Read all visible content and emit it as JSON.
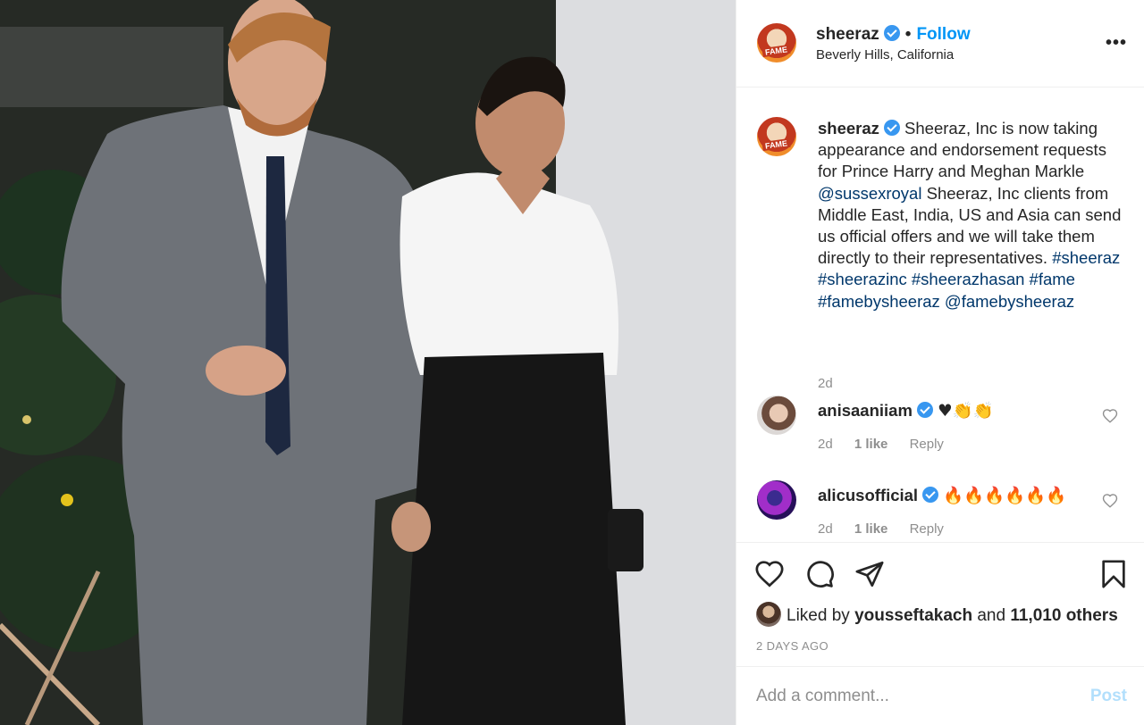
{
  "post": {
    "username": "sheeraz",
    "verified": true,
    "follow_label": "Follow",
    "separator": "•",
    "location": "Beverly Hills, California",
    "more_icon": "more-horizontal-icon",
    "more_label": "•••",
    "avatar_badge": "FAME"
  },
  "caption": {
    "username": "sheeraz",
    "text_before": "Sheeraz, Inc is now taking appearance and endorsement requests for Prince Harry and Meghan Markle",
    "mention_1": "@sussexroyal",
    "text_after": "Sheeraz, Inc clients from Middle East, India, US and Asia can send us official offers and we will take them directly to their representatives.",
    "hashtags": "#sheeraz #sheerazinc #sheerazhasan #fame #famebysheeraz",
    "mention_2": "@famebysheeraz",
    "timestamp": "2d"
  },
  "comments": [
    {
      "username": "anisaaniiam",
      "verified": true,
      "text": "♥👏👏",
      "time": "2d",
      "likes": "1 like",
      "reply": "Reply"
    },
    {
      "username": "alicusofficial",
      "verified": true,
      "text": "🔥🔥🔥🔥🔥🔥",
      "time": "2d",
      "likes": "1 like",
      "reply": "Reply"
    }
  ],
  "actions": {
    "like_icon": "heart-icon",
    "comment_icon": "comment-icon",
    "share_icon": "paper-plane-icon",
    "save_icon": "bookmark-icon"
  },
  "likes": {
    "prefix": "Liked by",
    "user": "yousseftakach",
    "joiner": "and",
    "others": "11,010 others"
  },
  "date": "2 DAYS AGO",
  "add_comment": {
    "placeholder": "Add a comment...",
    "post_label": "Post"
  },
  "colors": {
    "link": "#00376b",
    "follow": "#0095f6",
    "verified": "#3897f0",
    "muted": "#8e8e8e",
    "post_disabled": "#b2dffc"
  }
}
